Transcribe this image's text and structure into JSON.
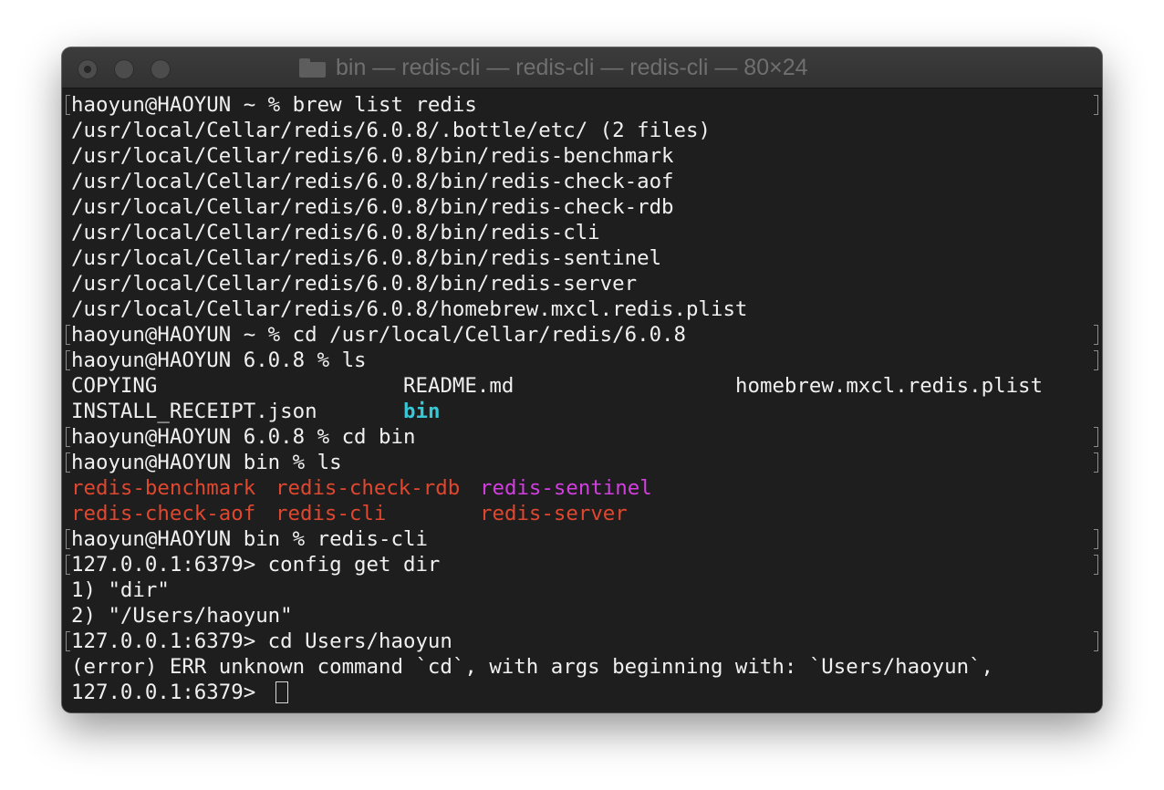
{
  "window": {
    "title": "bin — redis-cli — redis-cli — redis-cli — 80×24"
  },
  "terminal": {
    "lines": [
      "haoyun@HAOYUN ~ % brew list redis",
      "/usr/local/Cellar/redis/6.0.8/.bottle/etc/ (2 files)",
      "/usr/local/Cellar/redis/6.0.8/bin/redis-benchmark",
      "/usr/local/Cellar/redis/6.0.8/bin/redis-check-aof",
      "/usr/local/Cellar/redis/6.0.8/bin/redis-check-rdb",
      "/usr/local/Cellar/redis/6.0.8/bin/redis-cli",
      "/usr/local/Cellar/redis/6.0.8/bin/redis-sentinel",
      "/usr/local/Cellar/redis/6.0.8/bin/redis-server",
      "/usr/local/Cellar/redis/6.0.8/homebrew.mxcl.redis.plist",
      "haoyun@HAOYUN ~ % cd /usr/local/Cellar/redis/6.0.8",
      "haoyun@HAOYUN 6.0.8 % ls",
      "",
      "",
      "haoyun@HAOYUN 6.0.8 % cd bin",
      "haoyun@HAOYUN bin % ls",
      "",
      "",
      "haoyun@HAOYUN bin % redis-cli",
      "127.0.0.1:6379> config get dir",
      "1) \"dir\"",
      "2) \"/Users/haoyun\"",
      "127.0.0.1:6379> cd Users/haoyun",
      "(error) ERR unknown command `cd`, with args beginning with: `Users/haoyun`,",
      "127.0.0.1:6379> "
    ],
    "ls_output_1": {
      "col1": [
        "COPYING",
        "INSTALL_RECEIPT.json"
      ],
      "col2": [
        "README.md",
        "bin"
      ],
      "col3": [
        "homebrew.mxcl.redis.plist"
      ]
    },
    "ls_output_2": {
      "col1": [
        "redis-benchmark",
        "redis-check-aof"
      ],
      "col2": [
        "redis-check-rdb",
        "redis-cli"
      ],
      "col3": [
        "redis-sentinel",
        "redis-server"
      ]
    },
    "colors": {
      "directory": "#36c8d6",
      "executable": "#e0472f",
      "sentinel": "#d43ee0"
    }
  }
}
